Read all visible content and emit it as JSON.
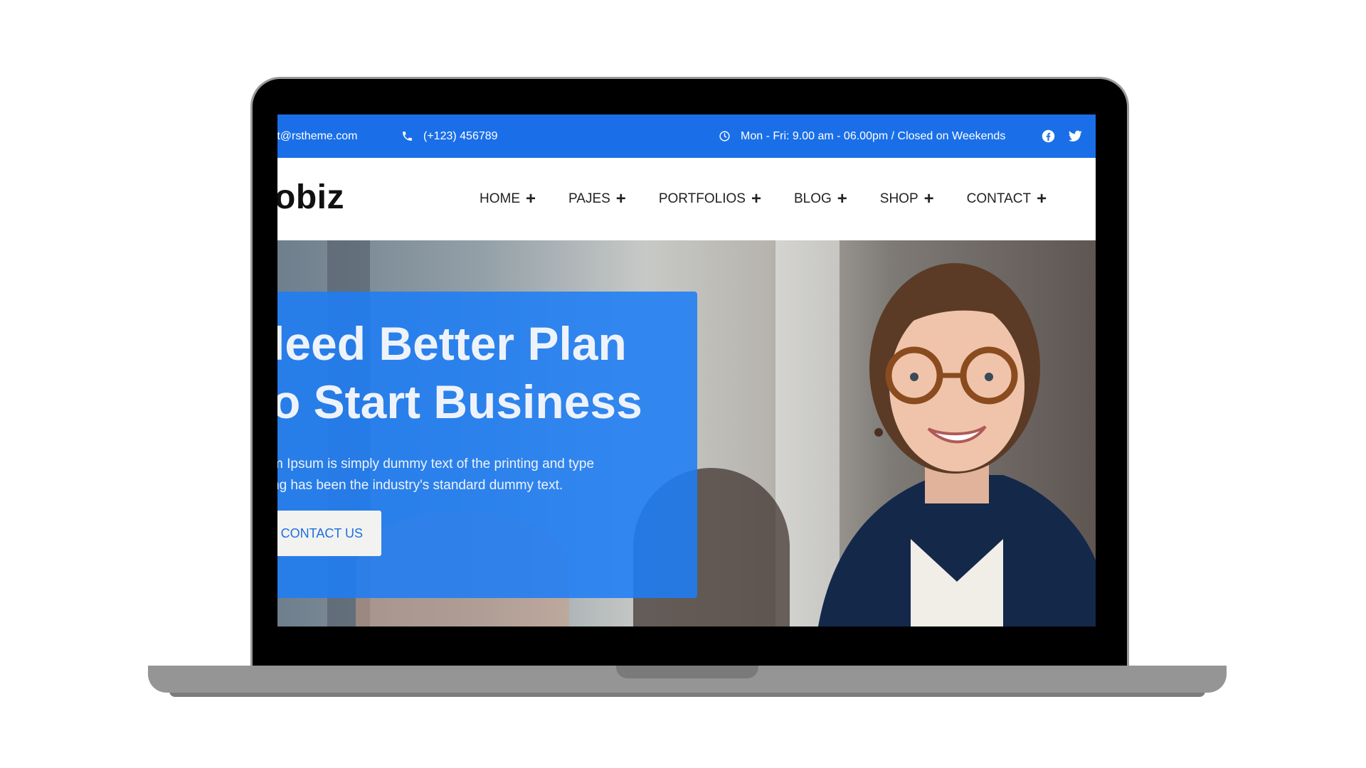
{
  "topbar": {
    "email": "rt@rstheme.com",
    "phone": "(+123) 456789",
    "hours": "Mon - Fri: 9.00 am - 06.00pm / Closed on Weekends",
    "icons": {
      "phone": "phone-icon",
      "hours": "clock-icon",
      "facebook": "facebook-icon",
      "twitter": "twitter-icon"
    }
  },
  "header": {
    "logo": "obiz",
    "nav": [
      {
        "label": "HOME"
      },
      {
        "label": "PAJES"
      },
      {
        "label": "PORTFOLIOS"
      },
      {
        "label": "BLOG"
      },
      {
        "label": "SHOP"
      },
      {
        "label": "CONTACT"
      }
    ],
    "nav_plus": "+"
  },
  "hero": {
    "title_line1": "leed Better Plan",
    "title_line2": "o Start Business",
    "text_line1": "m Ipsum is simply dummy text of the printing and type",
    "text_line2": "ng has been the industry's standard dummy text.",
    "button": "CONTACT US"
  },
  "colors": {
    "accent": "#1a6fe8",
    "panel": "#1e7df5",
    "button_bg": "#f2f2f0",
    "button_text": "#1e6fe0"
  }
}
